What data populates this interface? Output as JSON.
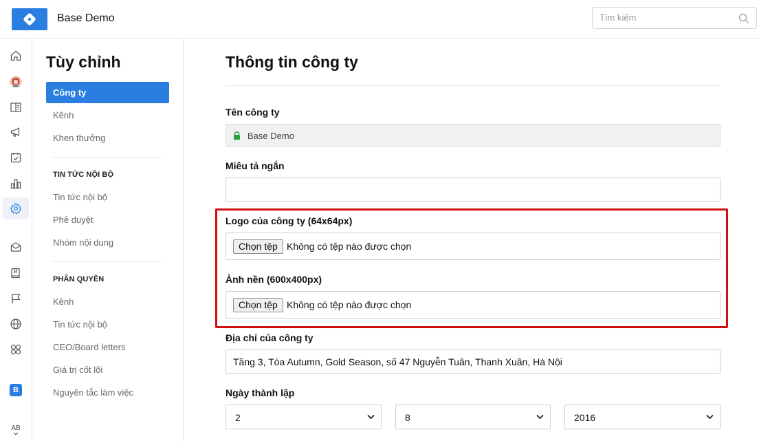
{
  "app": {
    "title": "Base Demo"
  },
  "search": {
    "placeholder": "Tìm kiếm"
  },
  "rail": {
    "icons": [
      "home-icon",
      "avatar-icon",
      "book-panel-icon",
      "megaphone-icon",
      "checkbox-icon",
      "bar-chart-icon",
      "gear-icon",
      "mail-icon",
      "notebook-icon",
      "flag-icon",
      "globe-icon",
      "apps-icon"
    ],
    "badge": "B",
    "language": "AB"
  },
  "sidebar": {
    "title": "Tùy chỉnh",
    "items": [
      {
        "label": "Công ty",
        "active": true
      },
      {
        "label": "Kênh"
      },
      {
        "label": "Khen thưởng"
      }
    ],
    "sections": [
      {
        "title": "TIN TỨC NỘI BỘ",
        "items": [
          "Tin tức nội bộ",
          "Phê duyệt",
          "Nhóm nội dung"
        ]
      },
      {
        "title": "PHÂN QUYỀN",
        "items": [
          "Kênh",
          "Tin tức nội bộ",
          "CEO/Board letters",
          "Giá trị cốt lõi",
          "Nguyên tắc làm việc"
        ]
      }
    ]
  },
  "main": {
    "title": "Thông tin công ty",
    "company_name": {
      "label": "Tên công ty",
      "value": "Base Demo"
    },
    "short_description": {
      "label": "Miêu tả ngắn",
      "value": ""
    },
    "logo": {
      "label": "Logo của công ty (64x64px)",
      "button": "Chọn tệp",
      "status": "Không có tệp nào được chọn"
    },
    "background": {
      "label": "Ảnh nền (600x400px)",
      "button": "Chọn tệp",
      "status": "Không có tệp nào được chọn"
    },
    "address": {
      "label": "Địa chỉ của công ty",
      "value": "Tầng 3, Tòa Autumn, Gold Season, số 47 Nguyễn Tuân, Thanh Xuân, Hà Nội"
    },
    "founded": {
      "label": "Ngày thành lập",
      "day": "2",
      "month": "8",
      "year": "2016"
    }
  },
  "colors": {
    "accent": "#2a7ee0",
    "highlight": "#d30f0f"
  }
}
